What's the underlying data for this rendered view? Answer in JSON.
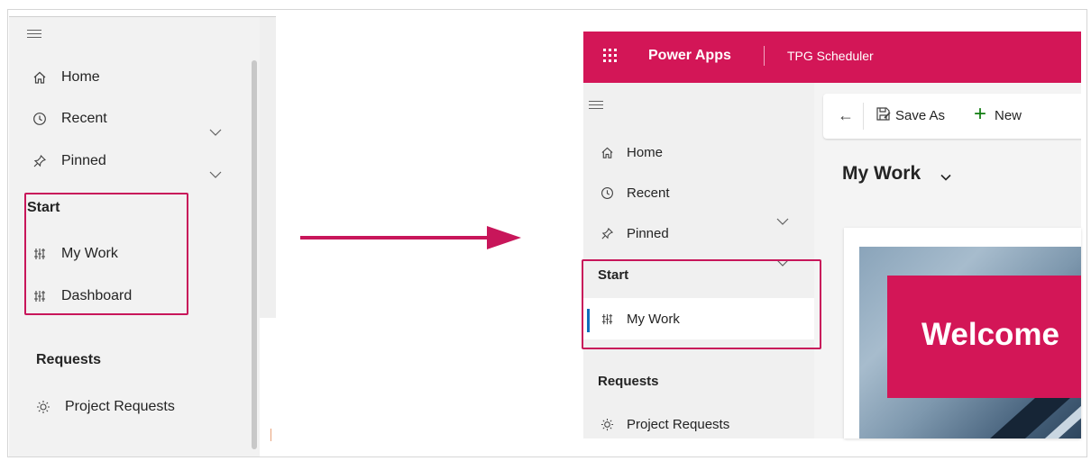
{
  "before": {
    "nav": {
      "items": [
        {
          "label": "Home",
          "icon": "home-icon"
        },
        {
          "label": "Recent",
          "icon": "clock-icon",
          "expandable": true
        },
        {
          "label": "Pinned",
          "icon": "pin-icon",
          "expandable": true
        }
      ],
      "start_section": {
        "title": "Start",
        "items": [
          {
            "label": "My Work",
            "icon": "dashboard-icon"
          },
          {
            "label": "Dashboard",
            "icon": "dashboard-icon"
          }
        ]
      },
      "requests_section": {
        "title": "Requests",
        "items": [
          {
            "label": "Project Requests",
            "icon": "lightbulb-icon"
          }
        ]
      }
    }
  },
  "after": {
    "header": {
      "app_name": "Power Apps",
      "environment": "TPG Scheduler"
    },
    "nav": {
      "items": [
        {
          "label": "Home",
          "icon": "home-icon"
        },
        {
          "label": "Recent",
          "icon": "clock-icon",
          "expandable": true
        },
        {
          "label": "Pinned",
          "icon": "pin-icon",
          "expandable": true
        }
      ],
      "start_section": {
        "title": "Start",
        "items": [
          {
            "label": "My Work",
            "icon": "dashboard-icon",
            "selected": true
          }
        ]
      },
      "requests_section": {
        "title": "Requests",
        "items": [
          {
            "label": "Project Requests",
            "icon": "lightbulb-icon"
          }
        ]
      }
    },
    "command_bar": {
      "save_as_label": "Save As",
      "new_label": "New"
    },
    "view_title": "My Work",
    "welcome_text": "Welcome"
  },
  "colors": {
    "accent": "#d31657",
    "highlight_border": "#c8165a",
    "selected_indicator": "#0f6cbd",
    "new_icon": "#107c10"
  }
}
